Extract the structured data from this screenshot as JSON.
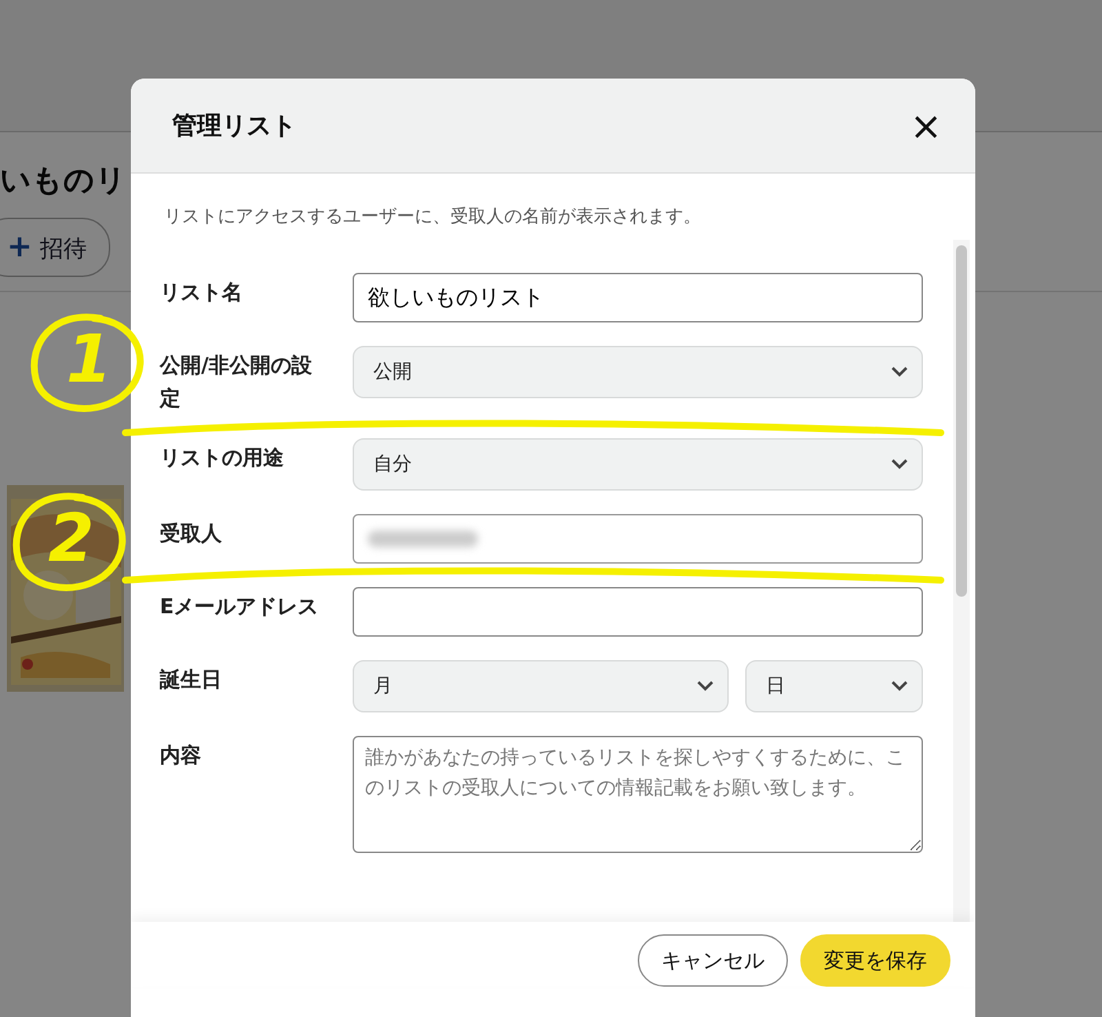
{
  "background_page": {
    "heading": "いものリ",
    "invite_button": {
      "icon": "+",
      "label": "招待"
    }
  },
  "dialog": {
    "title": "管理リスト",
    "close": "×",
    "description": "リストにアクセスするユーザーに、受取人の名前が表示されます。",
    "fields": [
      {
        "kind": "text",
        "label": "リスト名",
        "value": "欲しいものリスト"
      },
      {
        "kind": "select",
        "label": "公開/非公開の設定",
        "value": "公開"
      },
      {
        "kind": "select",
        "label": "リストの用途",
        "value": "自分"
      },
      {
        "kind": "blurred",
        "label": "受取人"
      },
      {
        "kind": "text",
        "label": "Eメールアドレス"
      },
      {
        "kind": "date",
        "label": "誕生日",
        "month": "月",
        "day": "日"
      },
      {
        "kind": "textarea",
        "label": "内容",
        "placeholder": "誰かがあなたの持っているリストを探しやすくするために、このリストの受取人についての情報記載をお願い致します。"
      }
    ],
    "buttons": [
      {
        "kind": "secondary",
        "label": "キャンセル"
      },
      {
        "kind": "primary",
        "label": "変更を保存"
      }
    ]
  },
  "annotations": [
    {
      "label": "1"
    },
    {
      "label": "2"
    }
  ]
}
